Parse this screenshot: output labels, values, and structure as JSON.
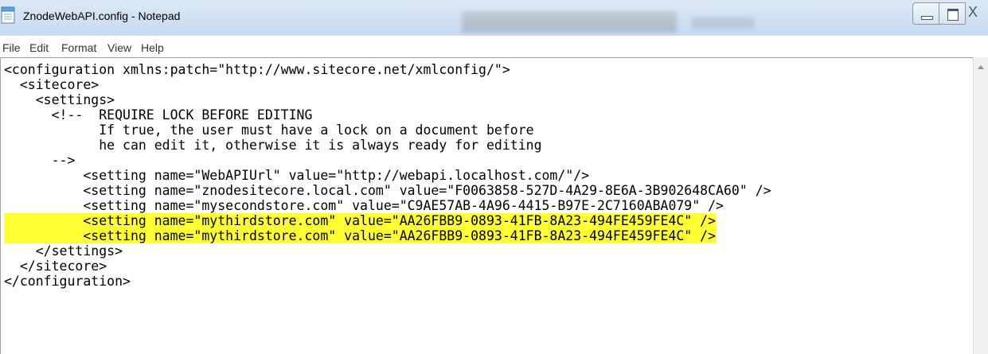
{
  "window": {
    "title": "ZnodeWebAPI.config - Notepad",
    "icon": "notepad-icon",
    "controls": {
      "minimize": "minimize-icon",
      "maximize": "maximize-icon",
      "close_glyph": "X"
    }
  },
  "menu": {
    "items": [
      "File",
      "Edit",
      "Format",
      "View",
      "Help"
    ]
  },
  "editor": {
    "highlight_color": "#ffff33",
    "lines": [
      {
        "text": "<configuration xmlns:patch=\"http://www.sitecore.net/xmlconfig/\">",
        "highlighted": false
      },
      {
        "text": "  <sitecore>",
        "highlighted": false
      },
      {
        "text": "    <settings>",
        "highlighted": false
      },
      {
        "text": "      <!--  REQUIRE LOCK BEFORE EDITING",
        "highlighted": false
      },
      {
        "text": "            If true, the user must have a lock on a document before",
        "highlighted": false
      },
      {
        "text": "            he can edit it, otherwise it is always ready for editing",
        "highlighted": false
      },
      {
        "text": "      -->",
        "highlighted": false
      },
      {
        "text": "          <setting name=\"WebAPIUrl\" value=\"http://webapi.localhost.com/\"/>",
        "highlighted": false
      },
      {
        "text": "          <setting name=\"znodesitecore.local.com\" value=\"F0063858-527D-4A29-8E6A-3B902648CA60\" />",
        "highlighted": false
      },
      {
        "text": "          <setting name=\"mysecondstore.com\" value=\"C9AE57AB-4A96-4415-B97E-2C7160ABA079\" />",
        "highlighted": false
      },
      {
        "text": "          <setting name=\"mythirdstore.com\" value=\"AA26FBB9-0893-41FB-8A23-494FE459FE4C\" />",
        "highlighted": true
      },
      {
        "text": "          <setting name=\"mythirdstore.com\" value=\"AA26FBB9-0893-41FB-8A23-494FE459FE4C\" />",
        "highlighted": true
      },
      {
        "text": "    </settings>",
        "highlighted": false
      },
      {
        "text": "  </sitecore>",
        "highlighted": false
      },
      {
        "text": "</configuration>",
        "highlighted": false
      }
    ]
  }
}
